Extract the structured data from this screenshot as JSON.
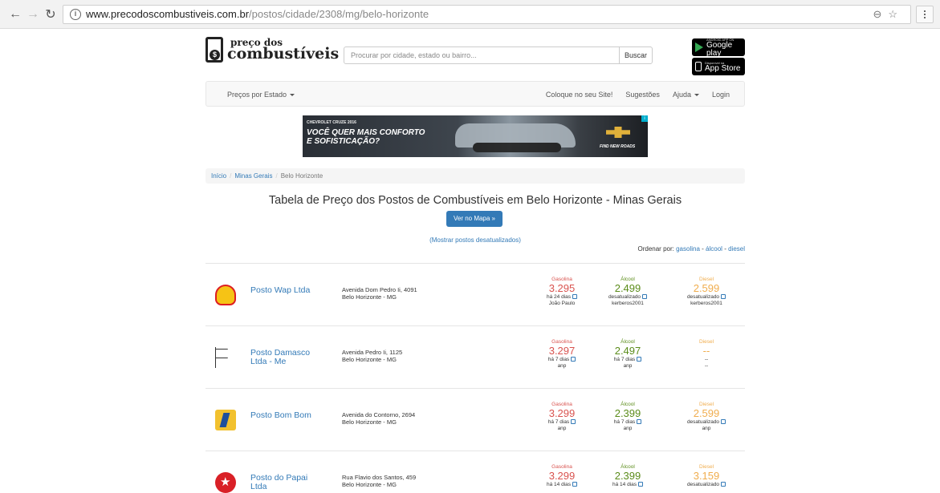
{
  "browser": {
    "url_host": "www.precodoscombustiveis.com.br",
    "url_path": "/postos/cidade/2308/mg/belo-horizonte"
  },
  "header": {
    "logo_line1": "preço dos",
    "logo_line2": "combustíveis",
    "search_placeholder": "Procurar por cidade, estado ou bairro...",
    "search_button": "Buscar",
    "google_play_small": "ANDROID APP ON",
    "google_play_label": "Google play",
    "app_store_small": "Disponível na",
    "app_store_label": "App Store"
  },
  "navbar": {
    "states": "Preços por Estado",
    "put_on_site": "Coloque no seu Site!",
    "suggestions": "Sugestões",
    "help": "Ajuda",
    "login": "Login"
  },
  "ad": {
    "model": "CHEVROLET CRUZE 2016",
    "headline_1": "VOCÊ QUER MAIS CONFORTO",
    "headline_2": "E SOFISTICAÇÃO?",
    "tagline": "FIND NEW ROADS"
  },
  "breadcrumb": {
    "home": "Início",
    "state": "Minas Gerais",
    "city": "Belo Horizonte"
  },
  "main": {
    "title": "Tabela de Preço dos Postos de Combustíveis em Belo Horizonte - Minas Gerais",
    "map_button": "Ver no Mapa »",
    "show_outdated": "(Mostrar postos desatualizados)",
    "sort_label": "Ordenar por:",
    "sort_gas": "gasolina",
    "sort_alc": "álcool",
    "sort_die": "diesel",
    "sort_sep": "-"
  },
  "fuel_labels": {
    "gas": "Gasolina",
    "alc": "Álcool",
    "die": "Diesel"
  },
  "stations": [
    {
      "name": "Posto Wap Ltda",
      "address": "Avenida Dom Pedro Ii, 4091",
      "city": "Belo Horizonte - MG",
      "brand_icon": "shell-logo-icon",
      "gas": {
        "price": "3.295",
        "meta": "há 24 dias",
        "source": "João Paulo"
      },
      "alc": {
        "price": "2.499",
        "meta": "desatualizado",
        "source": "kerberos2001"
      },
      "die": {
        "price": "2.599",
        "meta": "desatualizado",
        "source": "kerberos2001"
      }
    },
    {
      "name": "Posto Damasco Ltda - Me",
      "address": "Avenida Pedro Ii, 1125",
      "city": "Belo Horizonte - MG",
      "brand_icon": "flag-icon",
      "gas": {
        "price": "3.297",
        "meta": "há 7 dias",
        "source": "anp"
      },
      "alc": {
        "price": "2.497",
        "meta": "há 7 dias",
        "source": "anp"
      },
      "die": {
        "price": "--",
        "meta": "--",
        "source": "--"
      }
    },
    {
      "name": "Posto Bom Bom",
      "address": "Avenida do Contorno, 2694",
      "city": "Belo Horizonte - MG",
      "brand_icon": "ipiranga-logo-icon",
      "gas": {
        "price": "3.299",
        "meta": "há 7 dias",
        "source": "anp"
      },
      "alc": {
        "price": "2.399",
        "meta": "há 7 dias",
        "source": "anp"
      },
      "die": {
        "price": "2.599",
        "meta": "desatualizado",
        "source": "anp"
      }
    },
    {
      "name": "Posto do Papai Ltda",
      "address": "Rua Flavio dos Santos, 459",
      "city": "Belo Horizonte - MG",
      "brand_icon": "texaco-logo-icon",
      "gas": {
        "price": "3.299",
        "meta": "há 14 dias",
        "source": ""
      },
      "alc": {
        "price": "2.399",
        "meta": "há 14 dias",
        "source": ""
      },
      "die": {
        "price": "3.159",
        "meta": "desatualizado",
        "source": ""
      }
    }
  ]
}
